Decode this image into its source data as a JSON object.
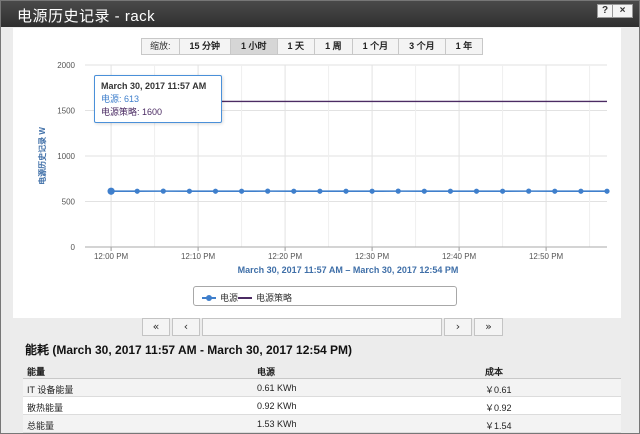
{
  "window": {
    "title": "电源历史记录 - rack",
    "help_label": "?",
    "close_label": "×"
  },
  "zoom": {
    "label": "缩放:",
    "options": [
      "15 分钟",
      "1 小时",
      "1 天",
      "1 周",
      "1 个月",
      "3 个月",
      "1 年"
    ],
    "selected": "1 小时"
  },
  "chart_data": {
    "type": "line",
    "ylabel": "电源历史记录 W",
    "xlabel": "March 30, 2017 11:57 AM – March 30, 2017 12:54 PM",
    "ylim": [
      0,
      2000
    ],
    "yticks": [
      "0",
      "500",
      "1000",
      "1500",
      "2000"
    ],
    "xticks": [
      "12:00 PM",
      "12:10 PM",
      "12:20 PM",
      "12:30 PM",
      "12:40 PM",
      "12:50 PM"
    ],
    "x_minutes": [
      0,
      3,
      6,
      9,
      12,
      15,
      18,
      21,
      24,
      27,
      30,
      33,
      36,
      39,
      42,
      45,
      48,
      51,
      54,
      57
    ],
    "series": [
      {
        "name": "电源",
        "color": "#3f7fcc",
        "values": [
          613,
          613,
          614,
          613,
          613,
          613,
          614,
          613,
          613,
          613,
          613,
          614,
          613,
          613,
          613,
          613,
          614,
          613,
          613,
          613
        ]
      },
      {
        "name": "电源策略",
        "color": "#4b2b63",
        "values": [
          1600,
          1600,
          1600,
          1600,
          1600,
          1600,
          1600,
          1600,
          1600,
          1600,
          1600,
          1600,
          1600,
          1600,
          1600,
          1600,
          1600,
          1600,
          1600,
          1600
        ]
      }
    ],
    "grid": true,
    "legend_position": "bottom"
  },
  "tooltip": {
    "title": "March 30, 2017 11:57 AM",
    "line1": "电源: 613",
    "line2": "电源策略: 1600"
  },
  "legend": {
    "power": "电源",
    "policy": "电源策略"
  },
  "nav": {
    "first": "«",
    "prev": "‹",
    "next": "›",
    "last": "»"
  },
  "energy": {
    "title": "能耗 (March 30, 2017 11:57 AM - March 30, 2017 12:54 PM)",
    "headers": [
      "能量",
      "电源",
      "成本"
    ],
    "rows": [
      [
        "IT 设备能量",
        "0.61 KWh",
        "￥0.61"
      ],
      [
        "散热能量",
        "0.92 KWh",
        "￥0.92"
      ],
      [
        "总能量",
        "1.53 KWh",
        "￥1.54"
      ]
    ]
  },
  "colors": {
    "titlebar": "#3a3a3a",
    "power_line": "#3f7fcc",
    "policy_line": "#4b2b63",
    "axis_title": "#3f6fa8"
  }
}
